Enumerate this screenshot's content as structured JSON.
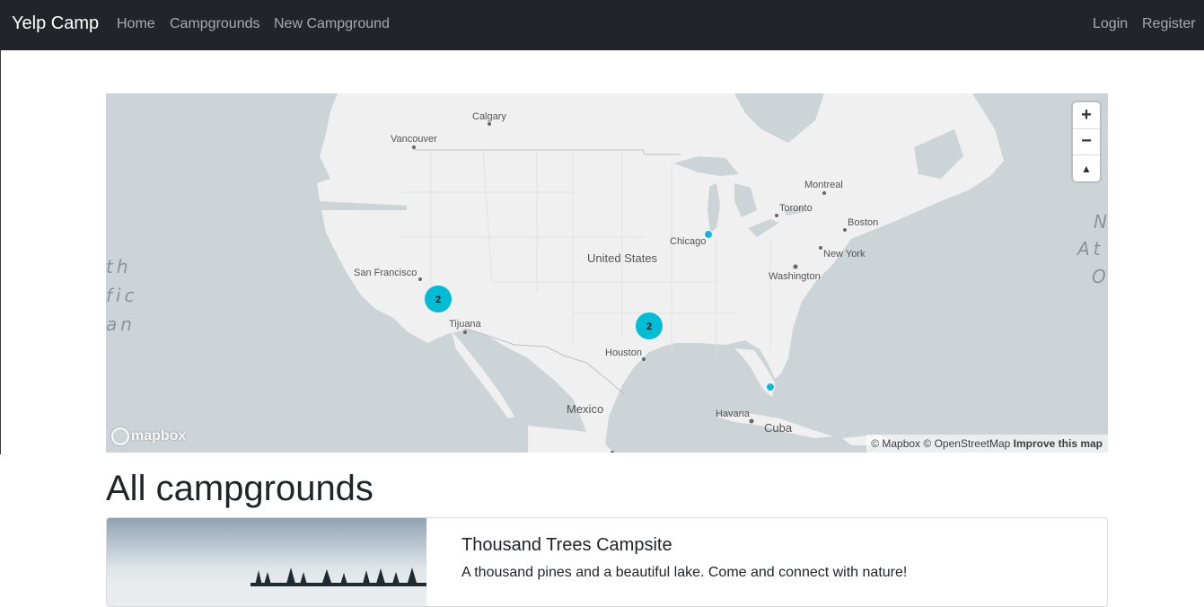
{
  "navbar": {
    "brand": "Yelp Camp",
    "links": [
      "Home",
      "Campgrounds",
      "New Campground"
    ],
    "right_links": [
      "Login",
      "Register"
    ]
  },
  "map": {
    "labels": {
      "calgary": "Calgary",
      "vancouver": "Vancouver",
      "montreal": "Montreal",
      "toronto": "Toronto",
      "boston": "Boston",
      "chicago": "Chicago",
      "united_states": "United States",
      "new_york": "New York",
      "washington": "Washington",
      "san_francisco": "San Francisco",
      "tijuana": "Tijuana",
      "houston": "Houston",
      "mexico": "Mexico",
      "havana": "Havana",
      "cuba": "Cuba",
      "pacific_1": "th",
      "pacific_2": "fic",
      "pacific_3": "an",
      "atlantic_1": "N",
      "atlantic_2": "At",
      "atlantic_3": "O"
    },
    "clusters": [
      "2",
      "2"
    ],
    "zoom_in": "+",
    "zoom_out": "−",
    "compass": "▲",
    "logo_text": "mapbox",
    "attribution": {
      "mapbox": "© Mapbox",
      "osm": "© OpenStreetMap",
      "improve": "Improve this map"
    },
    "colors": {
      "water": "#cdd4d7",
      "land": "#f0f0f0",
      "marker": "#11b4da",
      "cluster": "#00bcd4"
    }
  },
  "main": {
    "heading": "All campgrounds",
    "campgrounds": [
      {
        "title": "Thousand Trees Campsite",
        "description": "A thousand pines and a beautiful lake. Come and connect with nature!"
      }
    ]
  }
}
